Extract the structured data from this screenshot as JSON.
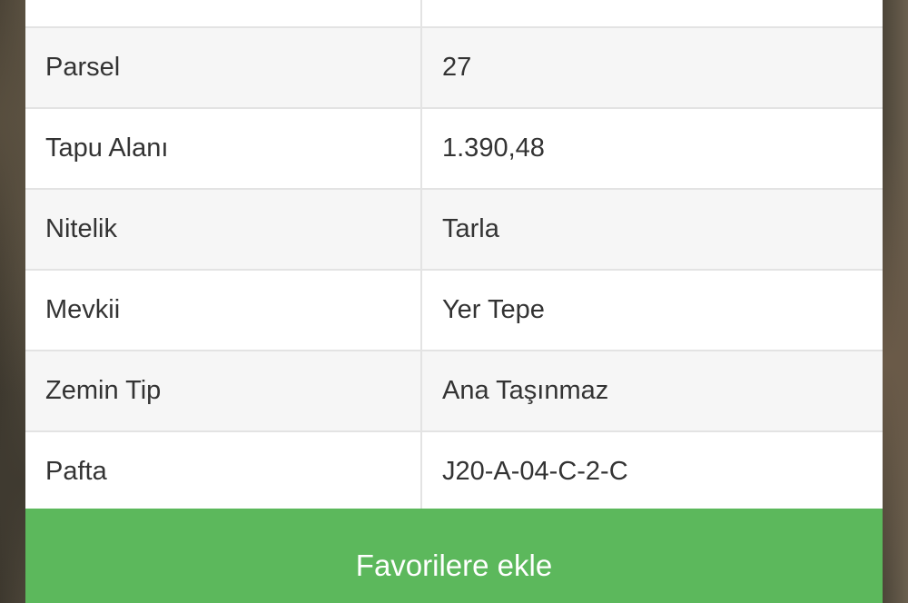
{
  "details": {
    "rows": [
      {
        "label": "",
        "value": ""
      },
      {
        "label": "Parsel",
        "value": "27"
      },
      {
        "label": "Tapu Alanı",
        "value": "1.390,48"
      },
      {
        "label": "Nitelik",
        "value": "Tarla"
      },
      {
        "label": "Mevkii",
        "value": "Yer Tepe"
      },
      {
        "label": "Zemin Tip",
        "value": "Ana Taşınmaz"
      },
      {
        "label": "Pafta",
        "value": "J20-A-04-C-2-C"
      }
    ]
  },
  "actions": {
    "favorite_label": "Favorilere ekle"
  },
  "colors": {
    "button_green": "#5cb85c",
    "row_alt": "#f6f6f6",
    "border": "#e3e3e3"
  }
}
